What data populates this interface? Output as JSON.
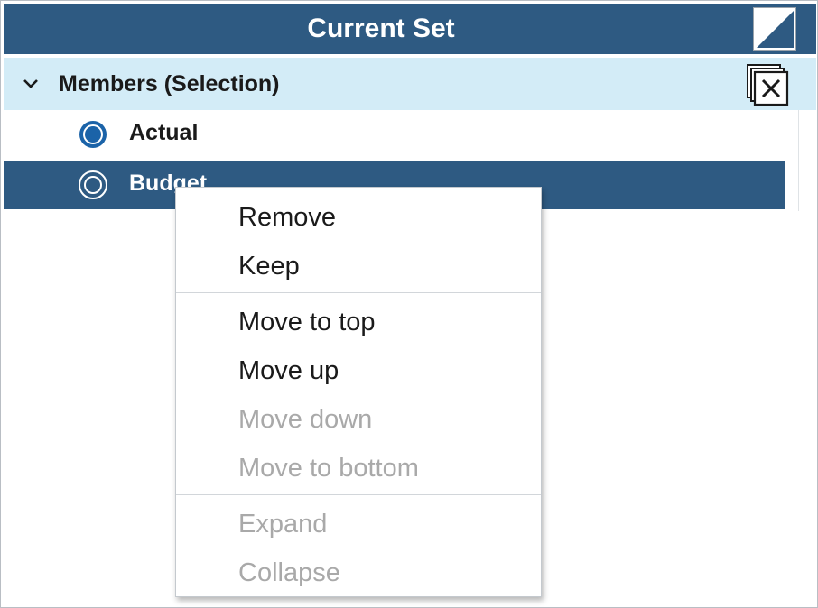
{
  "header": {
    "title": "Current Set"
  },
  "group": {
    "label": "Members (Selection)",
    "expanded": true
  },
  "members": [
    {
      "label": "Actual",
      "selected": false
    },
    {
      "label": "Budget",
      "selected": true
    }
  ],
  "context_menu": {
    "remove": "Remove",
    "keep": "Keep",
    "move_to_top": "Move to top",
    "move_up": "Move up",
    "move_down": "Move down",
    "move_to_bottom": "Move to bottom",
    "expand": "Expand",
    "collapse": "Collapse",
    "disabled_items": [
      "Move down",
      "Move to bottom",
      "Expand",
      "Collapse"
    ]
  },
  "colors": {
    "header_bg": "#2e5a82",
    "group_row_bg": "#d3ecf7",
    "selected_row_bg": "#2e5a82",
    "radio_blue": "#1b63a8",
    "disabled_text": "#a9a9a9"
  },
  "icons": {
    "header_right": "maximize-icon",
    "group_toggle": "chevron-down-icon",
    "group_action": "clear-selection-icon",
    "member_marker": "radio-icon"
  }
}
